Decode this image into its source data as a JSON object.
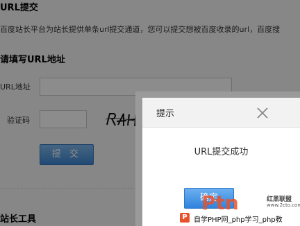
{
  "page": {
    "title": "URL提交",
    "description": "百度站长平台为站长提供单条url提交通道，您可以提交想被百度收录的url，百度搜",
    "section_title": "请填写URL地址",
    "url_label": "URL地址",
    "code_label": "验证码",
    "captcha_text": "R4H",
    "submit_label": "提 交",
    "tools_title": "站长工具"
  },
  "dialog": {
    "title": "提示",
    "message": "URL提交成功",
    "confirm_label": "确定"
  },
  "watermark": {
    "logo_text": "Ptn",
    "brand": "红黑联盟",
    "site": "www.2cto.com",
    "banner_icon": "P",
    "banner_text": "自学PHP网_php学习_php教"
  },
  "colors": {
    "accent": "#3f87d4",
    "overlay": "#000000",
    "watermark_red": "#e8522b"
  },
  "icons": {
    "dialog_close": "close-icon"
  }
}
